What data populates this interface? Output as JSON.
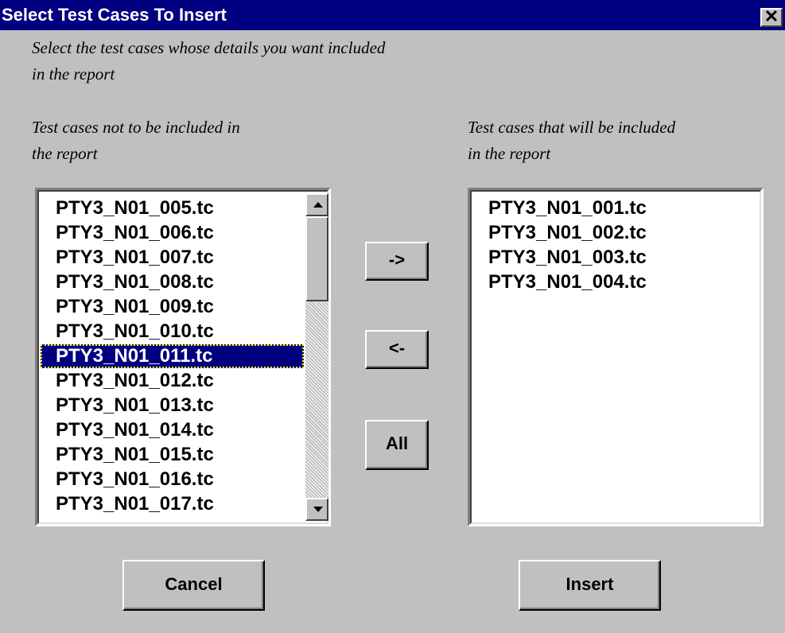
{
  "window": {
    "title": "Select Test Cases To Insert",
    "close_glyph": "✕"
  },
  "instructions": {
    "line1": "Select the test cases whose details you want included",
    "line2": "in the report"
  },
  "left_panel": {
    "label_line1": "Test cases not to be included in",
    "label_line2": "the report",
    "items": [
      "PTY3_N01_005.tc",
      "PTY3_N01_006.tc",
      "PTY3_N01_007.tc",
      "PTY3_N01_008.tc",
      "PTY3_N01_009.tc",
      "PTY3_N01_010.tc",
      "PTY3_N01_011.tc",
      "PTY3_N01_012.tc",
      "PTY3_N01_013.tc",
      "PTY3_N01_014.tc",
      "PTY3_N01_015.tc",
      "PTY3_N01_016.tc",
      "PTY3_N01_017.tc"
    ],
    "selected_item": "PTY3_N01_011.tc"
  },
  "right_panel": {
    "label_line1": "Test cases that will be included",
    "label_line2": "in the report",
    "items": [
      "PTY3_N01_001.tc",
      "PTY3_N01_002.tc",
      "PTY3_N01_003.tc",
      "PTY3_N01_004.tc"
    ]
  },
  "transfer_buttons": {
    "add_label": "->",
    "remove_label": "<-",
    "all_label": "All"
  },
  "footer": {
    "cancel_label": "Cancel",
    "insert_label": "Insert"
  },
  "colors": {
    "titlebar": "#000080",
    "dialog_face": "#c0c0c0",
    "selection": "#000080"
  }
}
